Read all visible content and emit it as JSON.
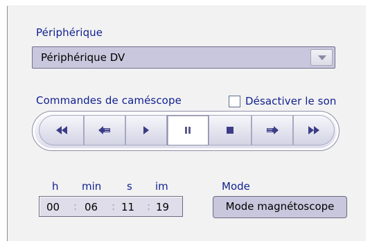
{
  "device": {
    "label": "Périphérique",
    "selected": "Périphérique DV",
    "arrow_icon": "chevron-down-icon"
  },
  "camcorder": {
    "label": "Commandes de caméscope",
    "mute_label": "Désactiver le son",
    "mute_checked": false,
    "buttons": [
      {
        "name": "rewind",
        "icon": "rewind-icon"
      },
      {
        "name": "step-back",
        "icon": "step-back-icon"
      },
      {
        "name": "play",
        "icon": "play-icon"
      },
      {
        "name": "pause",
        "icon": "pause-icon",
        "active": true
      },
      {
        "name": "stop",
        "icon": "stop-icon"
      },
      {
        "name": "step-forward",
        "icon": "step-forward-icon"
      },
      {
        "name": "fast-forward",
        "icon": "fast-forward-icon"
      }
    ]
  },
  "timecode": {
    "labels": {
      "h": "h",
      "min": "min",
      "s": "s",
      "im": "im"
    },
    "values": {
      "h": "00",
      "min": "06",
      "s": "11",
      "im": "19"
    },
    "separator": ":"
  },
  "mode": {
    "label": "Mode",
    "button_label": "Mode magnétoscope"
  },
  "colors": {
    "label_text": "#0f1f8f",
    "control_fill": "#c9c7dd",
    "icon_color": "#3c3c88"
  }
}
